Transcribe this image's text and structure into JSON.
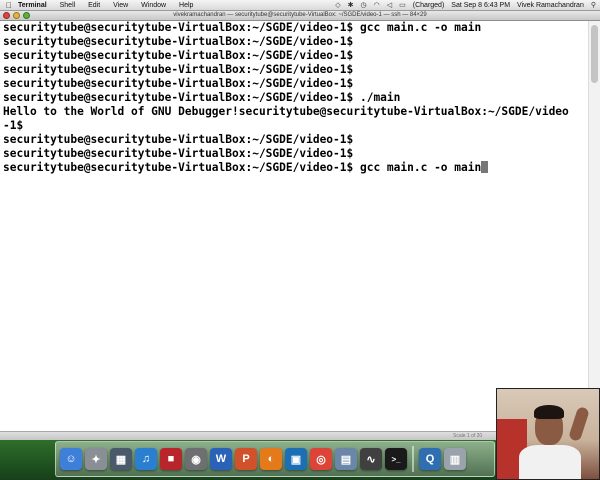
{
  "menubar": {
    "apple_glyph": "",
    "app_name": "Terminal",
    "menus": [
      "Shell",
      "Edit",
      "View",
      "Window",
      "Help"
    ],
    "battery": "(Charged)",
    "datetime": "Sat Sep 8  6:43 PM",
    "user": "Vivek Ramachandran"
  },
  "window": {
    "title": "vivekramachandran — securitytube@securitytube-VirtualBox: ~/SGDE/video-1 — ssh — 84×29"
  },
  "terminal": {
    "lines": [
      "securitytube@securitytube-VirtualBox:~/SGDE/video-1$ gcc main.c -o main",
      "securitytube@securitytube-VirtualBox:~/SGDE/video-1$",
      "securitytube@securitytube-VirtualBox:~/SGDE/video-1$",
      "securitytube@securitytube-VirtualBox:~/SGDE/video-1$",
      "securitytube@securitytube-VirtualBox:~/SGDE/video-1$",
      "securitytube@securitytube-VirtualBox:~/SGDE/video-1$ ./main",
      "Hello to the World of GNU Debugger!securitytube@securitytube-VirtualBox:~/SGDE/video",
      "-1$",
      "securitytube@securitytube-VirtualBox:~/SGDE/video-1$",
      "securitytube@securitytube-VirtualBox:~/SGDE/video-1$"
    ],
    "current_prompt": "securitytube@securitytube-VirtualBox:~/SGDE/video-1$ ",
    "current_input": "gcc main.c -o main"
  },
  "statusbar": {
    "info": "Scale 1 of 20"
  },
  "dock": {
    "icons": [
      {
        "name": "finder-icon",
        "glyph": "☺",
        "color": "#3d7fd9"
      },
      {
        "name": "launchpad-icon",
        "glyph": "✦",
        "color": "#8a8f96"
      },
      {
        "name": "mission-control-icon",
        "glyph": "▦",
        "color": "#4a5a6a"
      },
      {
        "name": "itunes-icon",
        "glyph": "♫",
        "color": "#2a7fd0"
      },
      {
        "name": "photo-booth-icon",
        "glyph": "■",
        "color": "#b8252a"
      },
      {
        "name": "camera-icon",
        "glyph": "◉",
        "color": "#6d6f70"
      },
      {
        "name": "word-icon",
        "glyph": "W",
        "color": "#2a62b8"
      },
      {
        "name": "powerpoint-icon",
        "glyph": "P",
        "color": "#d1512a"
      },
      {
        "name": "firefox-icon",
        "glyph": "◐",
        "color": "#e57a1a"
      },
      {
        "name": "virtualbox-icon",
        "glyph": "▣",
        "color": "#1d6fb5"
      },
      {
        "name": "chrome-icon",
        "glyph": "◎",
        "color": "#db4437"
      },
      {
        "name": "preview-icon",
        "glyph": "▤",
        "color": "#6a86a8"
      },
      {
        "name": "activity-monitor-icon",
        "glyph": "∿",
        "color": "#404040"
      },
      {
        "name": "terminal-icon",
        "glyph": ">_",
        "color": "#1a1a1a"
      },
      {
        "name": "quicktime-icon",
        "glyph": "Q",
        "color": "#2f6fb1"
      },
      {
        "name": "trash-icon",
        "glyph": "▥",
        "color": "#9aa3ac"
      }
    ]
  }
}
